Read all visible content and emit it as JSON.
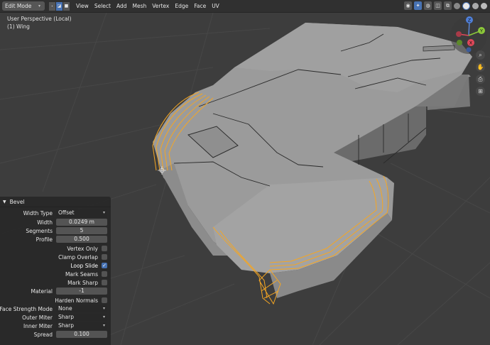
{
  "header": {
    "mode": "Edit Mode",
    "menus": [
      "View",
      "Select",
      "Add",
      "Mesh",
      "Vertex",
      "Edge",
      "Face",
      "UV"
    ]
  },
  "viewport": {
    "perspective_label": "User Perspective (Local)",
    "object_label": "(1) Wing",
    "gizmo": {
      "z": "Z",
      "y": "Y",
      "x": "X"
    }
  },
  "bevel_panel": {
    "title": "Bevel",
    "width_type": {
      "label": "Width Type",
      "value": "Offset"
    },
    "width": {
      "label": "Width",
      "value": "0.0249 m"
    },
    "segments": {
      "label": "Segments",
      "value": "5"
    },
    "profile": {
      "label": "Profile",
      "value": "0.500"
    },
    "vertex_only": {
      "label": "Vertex Only",
      "checked": false
    },
    "clamp_overlap": {
      "label": "Clamp Overlap",
      "checked": false
    },
    "loop_slide": {
      "label": "Loop Slide",
      "checked": true
    },
    "mark_seams": {
      "label": "Mark Seams",
      "checked": false
    },
    "mark_sharp": {
      "label": "Mark Sharp",
      "checked": false
    },
    "material": {
      "label": "Material",
      "value": "-1"
    },
    "harden_normals": {
      "label": "Harden Normals",
      "checked": false
    },
    "face_strength_mode": {
      "label": "Face Strength Mode",
      "value": "None"
    },
    "outer_miter": {
      "label": "Outer Miter",
      "value": "Sharp"
    },
    "inner_miter": {
      "label": "Inner Miter",
      "value": "Sharp"
    },
    "spread": {
      "label": "Spread",
      "value": "0.100"
    }
  },
  "colors": {
    "selection": "#f5a623",
    "mesh": "#9a9a9a",
    "background": "#3d3d3d",
    "accent": "#4772b3"
  }
}
